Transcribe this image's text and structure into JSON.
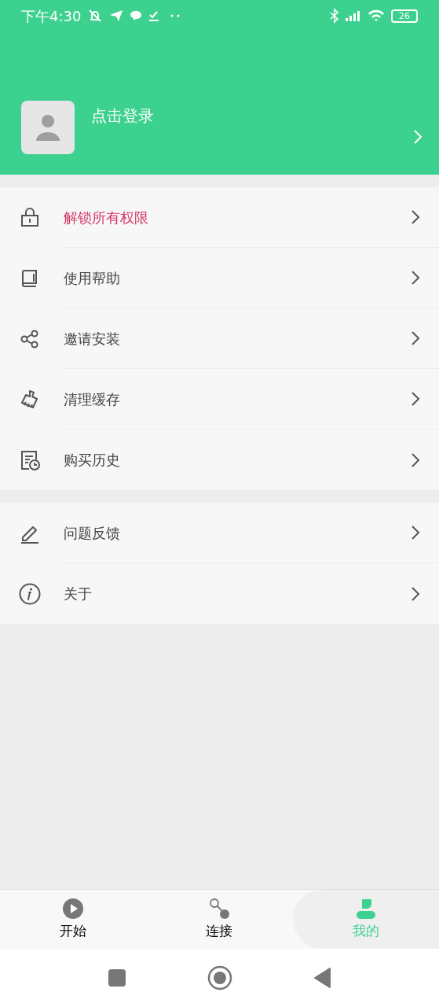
{
  "status_bar": {
    "time": "下午4:30",
    "battery": "26"
  },
  "profile": {
    "login_label": "点击登录"
  },
  "menu_groups": [
    {
      "items": [
        {
          "label": "解锁所有权限",
          "highlighted": true
        },
        {
          "label": "使用帮助",
          "highlighted": false
        },
        {
          "label": "邀请安装",
          "highlighted": false
        },
        {
          "label": "清理缓存",
          "highlighted": false
        },
        {
          "label": "购买历史",
          "highlighted": false
        }
      ]
    },
    {
      "items": [
        {
          "label": "问题反馈",
          "highlighted": false
        },
        {
          "label": "关于",
          "highlighted": false
        }
      ]
    }
  ],
  "tabs": [
    {
      "label": "开始",
      "selected": false
    },
    {
      "label": "连接",
      "selected": false
    },
    {
      "label": "我的",
      "selected": true
    }
  ]
}
